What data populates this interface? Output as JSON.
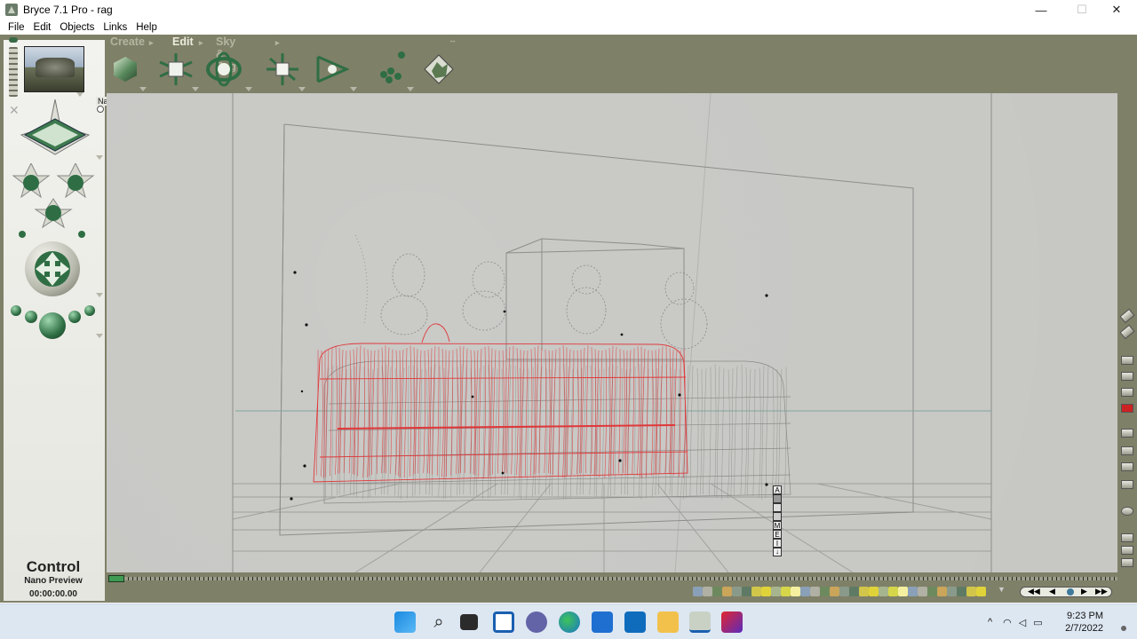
{
  "window": {
    "title": "Bryce 7.1  Pro - rag",
    "minimize": "—",
    "maximize": "☐",
    "close": "✕"
  },
  "menu": {
    "items": [
      "File",
      "Edit",
      "Objects",
      "Links",
      "Help"
    ]
  },
  "palette_tabs": {
    "create": "Create",
    "edit": "Edit",
    "sky": "Sky & Fog",
    "active": "Edit"
  },
  "viewport": {
    "preview_label": "Nano Preview"
  },
  "control_panel": {
    "title": "Control",
    "subtitle": "Nano Preview",
    "timecode": "00:00:00.00"
  },
  "display_mode_letters": [
    "A",
    "M",
    "E",
    "I"
  ],
  "taskbar": {
    "time": "9:23 PM",
    "date": "2/7/2022",
    "tray_chevron": "^"
  },
  "colors": {
    "frame": "#7f8068",
    "viewport": "#c7c7c4",
    "selected_wire": "#e0383a",
    "wire": "#8a8a86",
    "accent_green": "#3f9a53"
  }
}
